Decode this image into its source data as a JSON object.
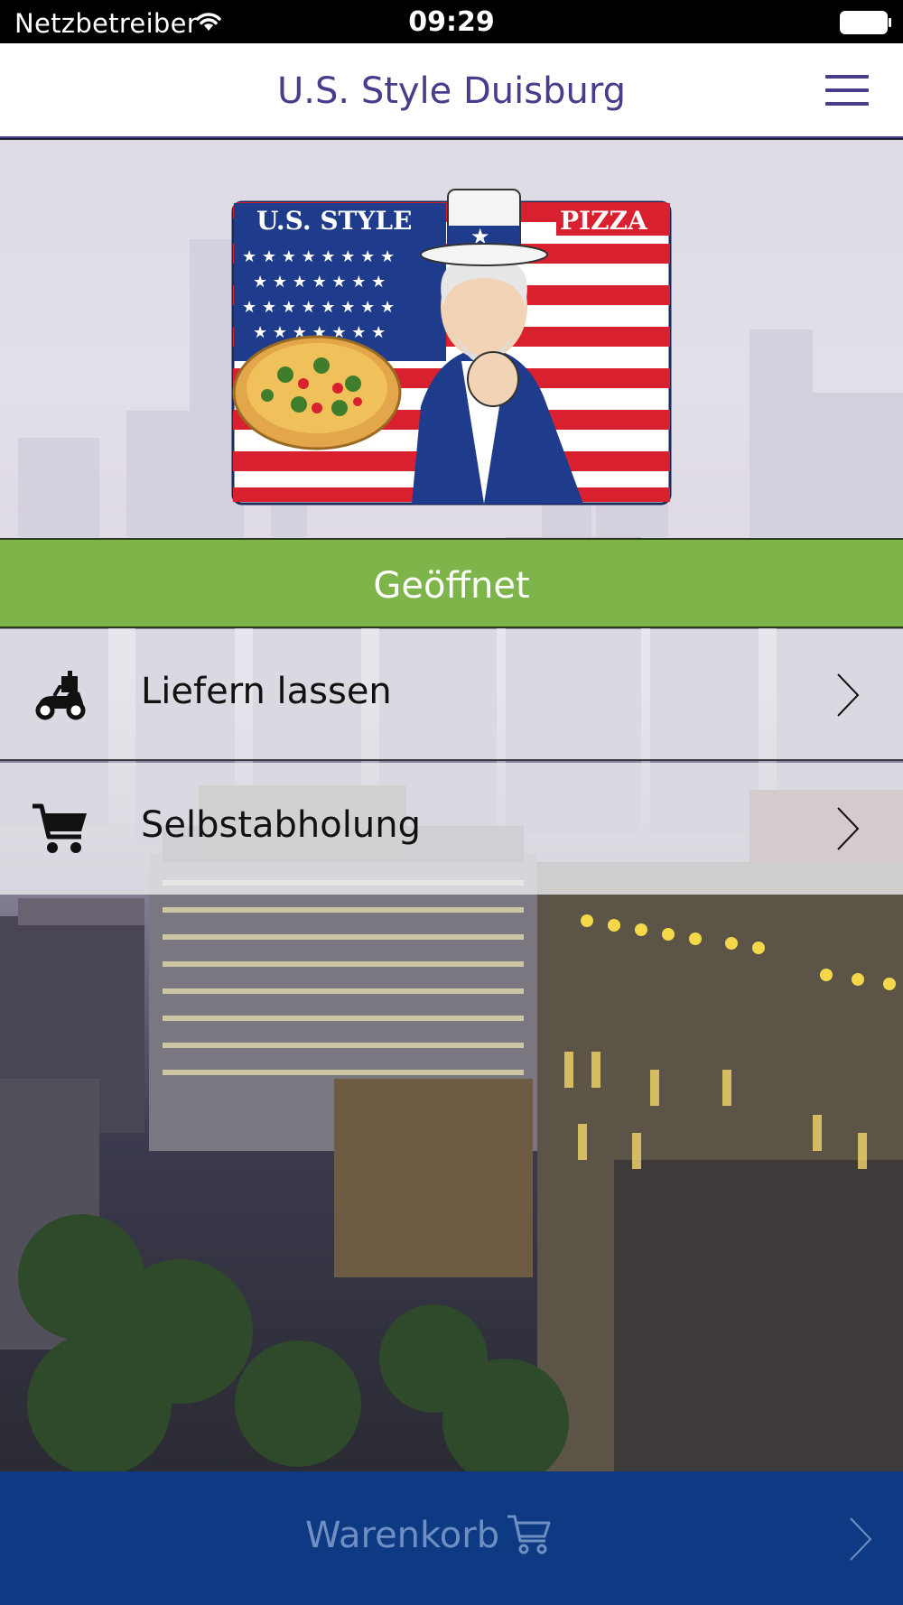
{
  "status_bar": {
    "carrier": "Netzbetreiber",
    "time": "09:29",
    "icons": [
      "wifi-icon",
      "battery-icon"
    ]
  },
  "nav": {
    "title": "U.S. Style Duisburg",
    "menu_icon": "hamburger-menu-icon"
  },
  "logo": {
    "left_text": "U.S. STYLE",
    "right_text": "PIZZA"
  },
  "status": {
    "label": "Geöffnet",
    "color": "#7db54a"
  },
  "options": [
    {
      "label": "Liefern lassen",
      "icon": "delivery-scooter-icon"
    },
    {
      "label": "Selbstabholung",
      "icon": "shopping-cart-icon"
    }
  ],
  "cart": {
    "label": "Warenkorb",
    "icon": "shopping-cart-icon",
    "background": "#0d3a82"
  },
  "colors": {
    "accent": "#4b3b8c"
  }
}
